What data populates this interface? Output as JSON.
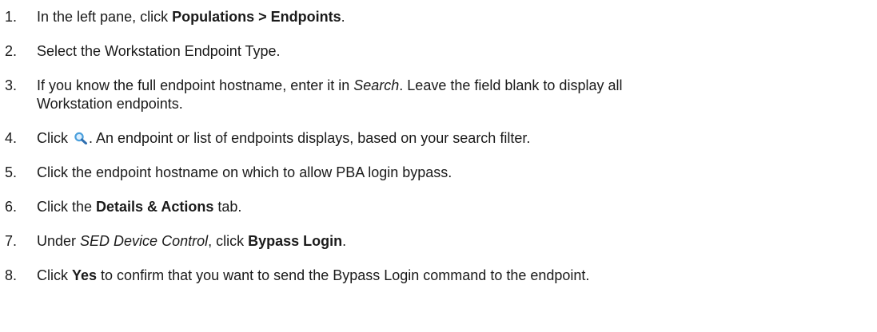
{
  "steps": [
    {
      "num": "1.",
      "parts": [
        {
          "t": "In the left pane, click "
        },
        {
          "t": "Populations > Endpoints",
          "style": "bold"
        },
        {
          "t": "."
        }
      ]
    },
    {
      "num": "2.",
      "parts": [
        {
          "t": "Select the Workstation Endpoint Type."
        }
      ]
    },
    {
      "num": "3.",
      "line1": [
        {
          "t": "If you know the full endpoint hostname, enter it in "
        },
        {
          "t": "Search",
          "style": "italic"
        },
        {
          "t": ". Leave the field blank to display all"
        }
      ],
      "line2": "Workstation endpoints."
    },
    {
      "num": "4.",
      "before_icon": "Click ",
      "icon": "search-icon",
      "after_icon": ". An endpoint or list of endpoints displays, based on your search filter."
    },
    {
      "num": "5.",
      "parts": [
        {
          "t": "Click the endpoint hostname on which to allow PBA login bypass."
        }
      ]
    },
    {
      "num": "6.",
      "parts": [
        {
          "t": "Click the "
        },
        {
          "t": "Details & Actions",
          "style": "bold"
        },
        {
          "t": " tab."
        }
      ]
    },
    {
      "num": "7.",
      "parts": [
        {
          "t": "Under "
        },
        {
          "t": "SED Device Control",
          "style": "italic"
        },
        {
          "t": ", click "
        },
        {
          "t": "Bypass Login",
          "style": "bold"
        },
        {
          "t": "."
        }
      ]
    },
    {
      "num": "8.",
      "parts": [
        {
          "t": "Click "
        },
        {
          "t": "Yes",
          "style": "bold"
        },
        {
          "t": " to confirm that you want to send the Bypass Login command to the endpoint."
        }
      ]
    }
  ],
  "colors": {
    "text": "#1a1a1a",
    "icon_lens": "#4a9fdc",
    "icon_handle": "#2f6fb0"
  }
}
